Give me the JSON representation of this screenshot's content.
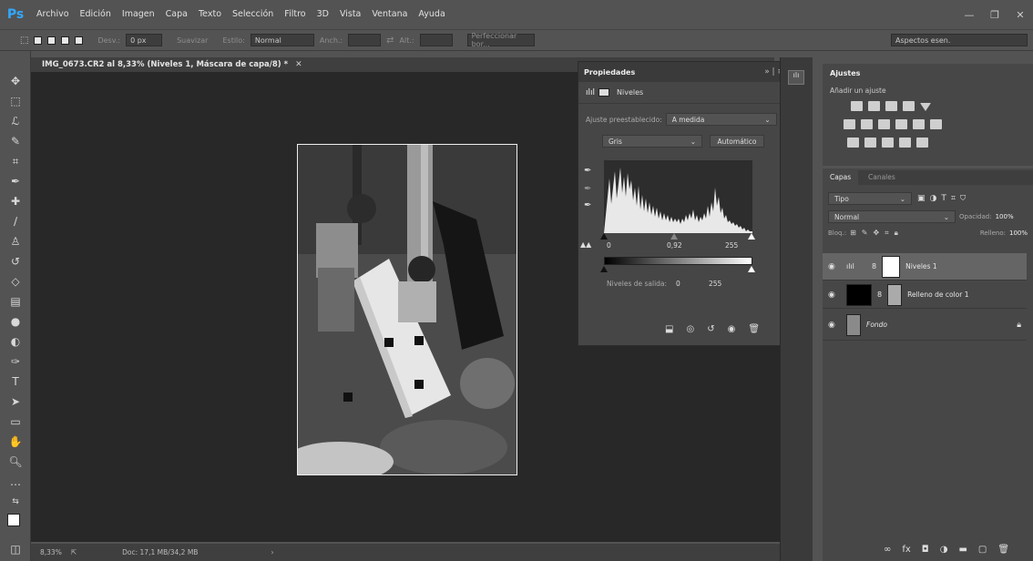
{
  "app": {
    "logo": "Ps"
  },
  "menu": [
    "Archivo",
    "Edición",
    "Imagen",
    "Capa",
    "Texto",
    "Selección",
    "Filtro",
    "3D",
    "Vista",
    "Ventana",
    "Ayuda"
  ],
  "options": {
    "desvan_label": "Desv.:",
    "desvan_value": "0 px",
    "suavizar": "Suavizar",
    "estilo_label": "Estilo:",
    "estilo_value": "Normal",
    "ancho_label": "Anch.:",
    "alto_label": "Alt.:",
    "perfeccionar": "Perfeccionar bor...",
    "workspace": "Aspectos esen."
  },
  "document": {
    "tab_title": "IMG_0673.CR2 al 8,33% (Niveles 1, Máscara de capa/8) *",
    "zoom": "8,33%",
    "doc_info": "Doc: 17,1 MB/34,2 MB"
  },
  "properties": {
    "title": "Propiedades",
    "panel_name": "Niveles",
    "preset_label": "Ajuste preestablecido:",
    "preset_value": "A medida",
    "channel": "Gris",
    "auto_button": "Automático",
    "input_black": "0",
    "input_gamma": "0,92",
    "input_white": "255",
    "output_label": "Niveles de salida:",
    "output_black": "0",
    "output_white": "255"
  },
  "ajustes": {
    "title": "Ajustes",
    "add_label": "Añadir un ajuste"
  },
  "capas": {
    "tabs": [
      "Capas",
      "Canales"
    ],
    "filter": "Tipo",
    "blend_mode": "Normal",
    "opacity_label": "Opacidad:",
    "opacity_value": "100%",
    "lock_label": "Bloq.:",
    "fill_label": "Relleno:",
    "fill_value": "100%",
    "layers": [
      "Niveles 1",
      "Relleno de color 1",
      "Fondo"
    ]
  }
}
